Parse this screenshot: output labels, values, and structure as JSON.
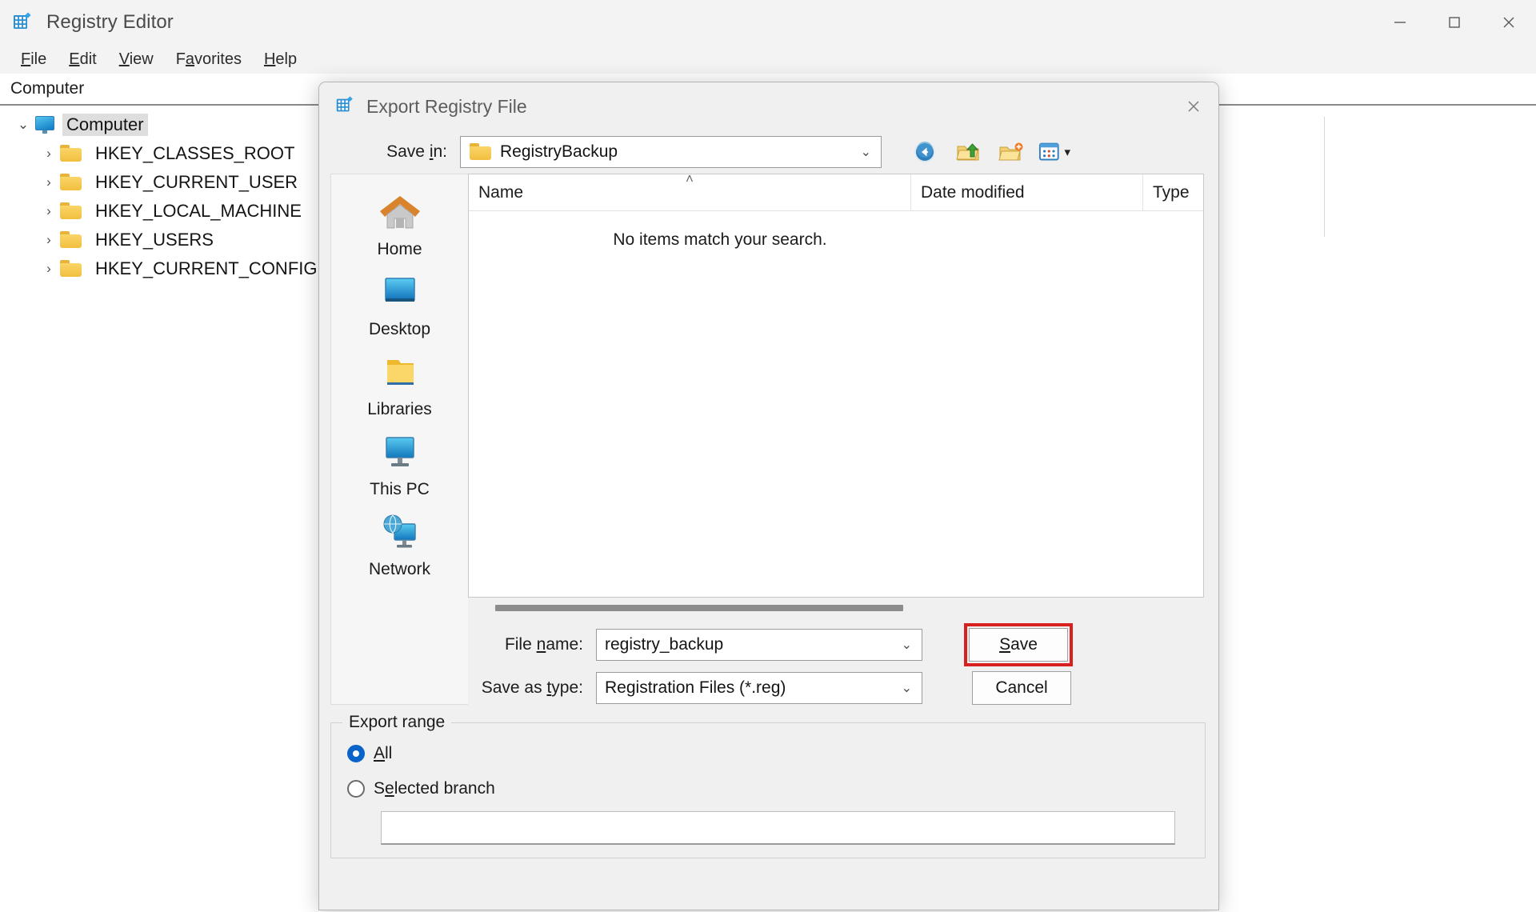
{
  "window": {
    "title": "Registry Editor",
    "icon": "registry-editor-icon",
    "controls": {
      "minimize": "—",
      "maximize": "☐",
      "close": "✕"
    }
  },
  "menubar": {
    "items": [
      {
        "label": "File",
        "accel": "F"
      },
      {
        "label": "Edit",
        "accel": "E"
      },
      {
        "label": "View",
        "accel": "V"
      },
      {
        "label": "Favorites",
        "accel": "a"
      },
      {
        "label": "Help",
        "accel": "H"
      }
    ]
  },
  "address": {
    "path": "Computer"
  },
  "tree": {
    "root": {
      "label": "Computer",
      "icon": "computer-icon",
      "expanded": true,
      "selected": true,
      "chevron": "⌄"
    },
    "children": [
      {
        "label": "HKEY_CLASSES_ROOT",
        "icon": "folder-icon",
        "chevron": "›"
      },
      {
        "label": "HKEY_CURRENT_USER",
        "icon": "folder-icon",
        "chevron": "›"
      },
      {
        "label": "HKEY_LOCAL_MACHINE",
        "icon": "folder-icon",
        "chevron": "›"
      },
      {
        "label": "HKEY_USERS",
        "icon": "folder-icon",
        "chevron": "›"
      },
      {
        "label": "HKEY_CURRENT_CONFIG",
        "icon": "folder-icon",
        "chevron": "›"
      }
    ]
  },
  "dialog": {
    "title": "Export Registry File",
    "icon": "registry-editor-icon",
    "close_label": "✕",
    "save_in": {
      "label": "Save in:",
      "accel": "i",
      "value": "RegistryBackup",
      "icon": "folder-icon",
      "caret": "⌄"
    },
    "toolbar": [
      {
        "name": "back-icon",
        "tooltip": "Back"
      },
      {
        "name": "up-folder-icon",
        "tooltip": "Up one level"
      },
      {
        "name": "new-folder-icon",
        "tooltip": "Create New Folder"
      },
      {
        "name": "views-icon",
        "tooltip": "Views",
        "caret": "▾"
      }
    ],
    "places": [
      {
        "label": "Home",
        "icon": "home-icon"
      },
      {
        "label": "Desktop",
        "icon": "desktop-icon"
      },
      {
        "label": "Libraries",
        "icon": "libraries-folder-icon"
      },
      {
        "label": "This PC",
        "icon": "this-pc-icon"
      },
      {
        "label": "Network",
        "icon": "network-icon"
      }
    ],
    "file_list": {
      "columns": [
        "Name",
        "Date modified",
        "Type"
      ],
      "sort_column": "Name",
      "sort_caret": "˄",
      "rows": [],
      "empty_message": "No items match your search."
    },
    "file_name": {
      "label": "File name:",
      "accel": "n",
      "value": "registry_backup",
      "caret": "⌄"
    },
    "save_as_type": {
      "label": "Save as type:",
      "accel": "t",
      "value": "Registration Files (*.reg)",
      "caret": "⌄"
    },
    "buttons": {
      "save": "Save",
      "save_accel": "S",
      "save_highlighted": true,
      "cancel": "Cancel"
    },
    "export_range": {
      "title": "Export range",
      "options": [
        {
          "label": "All",
          "accel": "A",
          "selected": true
        },
        {
          "label": "Selected branch",
          "accel": "e",
          "selected": false
        }
      ],
      "branch_value": ""
    }
  },
  "colors": {
    "accent": "#0a63c9",
    "highlight_border": "#d92020",
    "window_bg": "#f3f3f3",
    "dialog_bg": "#f0f0f0",
    "folder_yellow": "#f1bf3e"
  }
}
